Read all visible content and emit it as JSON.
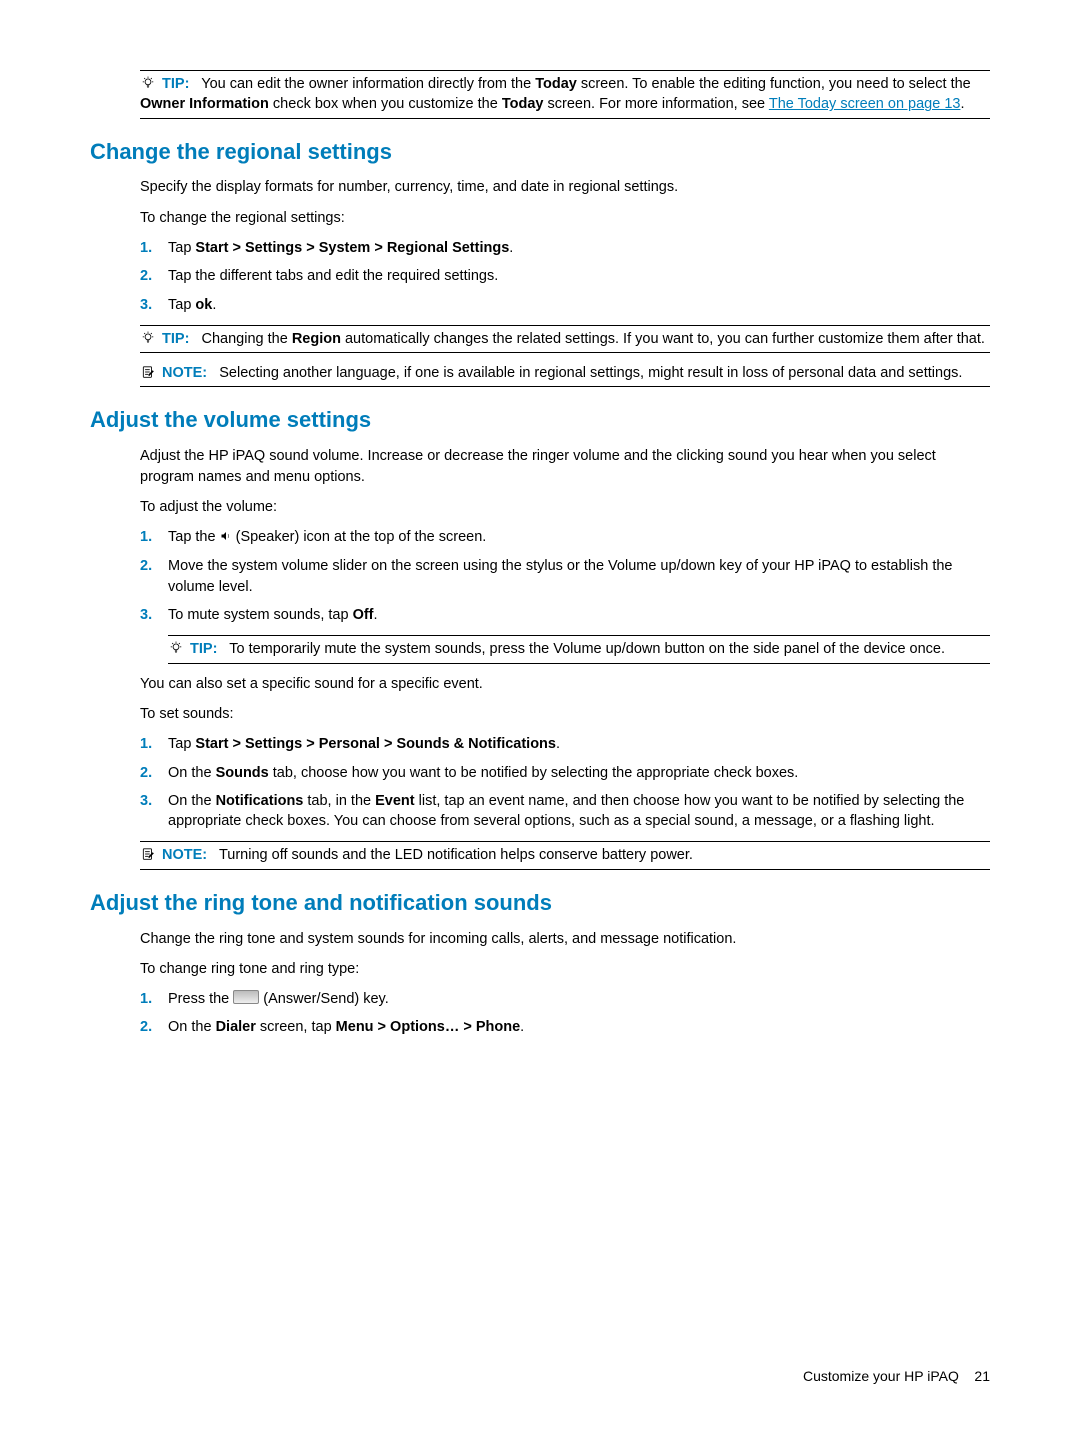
{
  "tips": {
    "t1_pre": "You can edit the owner information directly from the ",
    "t1_b1": "Today",
    "t1_mid1": " screen. To enable the editing function, you need to select the ",
    "t1_b2": "Owner Information",
    "t1_mid2": " check box when you customize the ",
    "t1_b3": "Today",
    "t1_mid3": " screen. For more information, see ",
    "t1_link": "The Today screen on page 13",
    "t1_post": ".",
    "t2_pre": "Changing the ",
    "t2_b1": "Region",
    "t2_post": " automatically changes the related settings. If you want to, you can further customize them after that.",
    "t3": "To temporarily mute the system sounds, press the Volume up/down button on the side panel of the device once."
  },
  "notes": {
    "n1": "Selecting another language, if one is available in regional settings, might result in loss of personal data and settings.",
    "n2": "Turning off sounds and the LED notification helps conserve battery power."
  },
  "labels": {
    "tip": "TIP:",
    "note": "NOTE:"
  },
  "sec1": {
    "heading": "Change the regional settings",
    "p1": "Specify the display formats for number, currency, time, and date in regional settings.",
    "p2": "To change the regional settings:",
    "steps": {
      "s1_pre": "Tap ",
      "s1_b": "Start > Settings > System > Regional Settings",
      "s1_post": ".",
      "s2": "Tap the different tabs and edit the required settings.",
      "s3_pre": "Tap ",
      "s3_b": "ok",
      "s3_post": "."
    }
  },
  "sec2": {
    "heading": "Adjust the volume settings",
    "p1": "Adjust the HP iPAQ sound volume. Increase or decrease the ringer volume and the clicking sound you hear when you select program names and menu options.",
    "p2": "To adjust the volume:",
    "stepsA": {
      "s1_pre": "Tap the ",
      "s1_post": " (Speaker) icon at the top of the screen.",
      "s2": "Move the system volume slider on the screen using the stylus or the Volume up/down key of your HP iPAQ to establish the volume level.",
      "s3_pre": "To mute system sounds, tap ",
      "s3_b": "Off",
      "s3_post": "."
    },
    "p3": "You can also set a specific sound for a specific event.",
    "p4": "To set sounds:",
    "stepsB": {
      "s1_pre": "Tap ",
      "s1_b": "Start > Settings > Personal > Sounds & Notifications",
      "s1_post": ".",
      "s2_pre": "On the ",
      "s2_b": "Sounds",
      "s2_post": " tab, choose how you want to be notified by selecting the appropriate check boxes.",
      "s3_pre": "On the ",
      "s3_b1": "Notifications",
      "s3_mid1": " tab, in the ",
      "s3_b2": "Event",
      "s3_post": " list, tap an event name, and then choose how you want to be notified by selecting the appropriate check boxes. You can choose from several options, such as a special sound, a message, or a flashing light."
    }
  },
  "sec3": {
    "heading": "Adjust the ring tone and notification sounds",
    "p1": "Change the ring tone and system sounds for incoming calls, alerts, and message notification.",
    "p2": "To change ring tone and ring type:",
    "steps": {
      "s1_pre": "Press the ",
      "s1_post": " (Answer/Send) key.",
      "s2_pre": "On the ",
      "s2_b1": "Dialer",
      "s2_mid": " screen, tap ",
      "s2_b2": "Menu > Options… > Phone",
      "s2_post": "."
    }
  },
  "footer": {
    "text": "Customize your HP iPAQ",
    "page": "21"
  },
  "nums": {
    "n1": "1.",
    "n2": "2.",
    "n3": "3."
  }
}
